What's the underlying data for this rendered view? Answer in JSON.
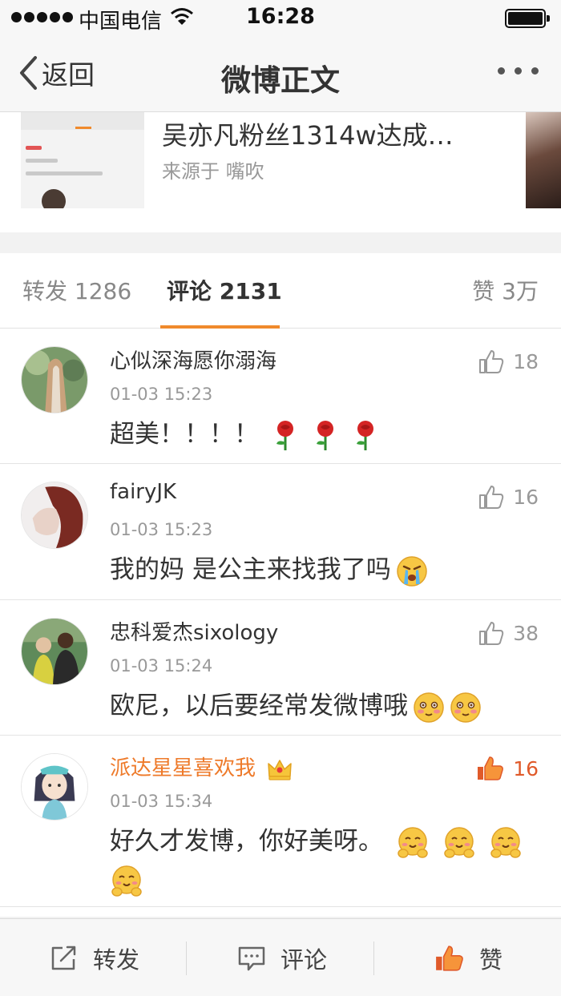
{
  "status_bar": {
    "carrier": "中国电信",
    "time": "16:28"
  },
  "nav": {
    "back_label": "返回",
    "title": "微博正文"
  },
  "shared_card": {
    "title": "吴亦凡粉丝1314w达成…",
    "source": "来源于 嘴吹"
  },
  "tabs": {
    "repost": "转发 1286",
    "comment": "评论 2131",
    "like": "赞 3万"
  },
  "comments": [
    {
      "username": "心似深海愿你溺海",
      "time": "01-03 15:23",
      "text": "超美！！！！",
      "emoji": "rose x3",
      "likes": "18",
      "liked": false
    },
    {
      "username": "fairyJK",
      "time": "01-03 15:23",
      "text": "我的妈 是公主来找我了吗",
      "emoji": "crying",
      "likes": "16",
      "liked": false
    },
    {
      "username": "忠科爱杰sixology",
      "time": "01-03 15:24",
      "text": "欧尼，以后要经常发微博哦",
      "emoji": "blush x2",
      "likes": "38",
      "liked": false
    },
    {
      "username": "派达星星喜欢我",
      "time": "01-03 15:34",
      "text": "好久才发博，你好美呀。",
      "emoji": "hug x4",
      "likes": "16",
      "liked": true,
      "vip_badge": "crown-icon"
    }
  ],
  "bottom_bar": {
    "repost": "转发",
    "comment": "评论",
    "like": "赞"
  },
  "colors": {
    "accent": "#f08a2c",
    "liked": "#e05a2a",
    "vip_name": "#ee7a2a",
    "muted_text": "#999999"
  }
}
